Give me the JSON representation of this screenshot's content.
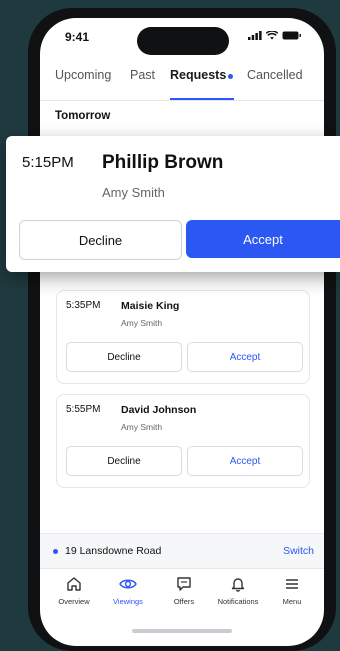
{
  "status_bar": {
    "time": "9:41"
  },
  "tabs": [
    {
      "label": "Upcoming"
    },
    {
      "label": "Past"
    },
    {
      "label": "Requests"
    },
    {
      "label": "Cancelled"
    }
  ],
  "active_tab": "Requests",
  "section_title": "Tomorrow",
  "highlight_request": {
    "time": "5:15PM",
    "name": "Phillip Brown",
    "agent": "Amy Smith",
    "decline_label": "Decline",
    "accept_label": "Accept"
  },
  "requests": [
    {
      "time": "5:35PM",
      "name": "Maisie King",
      "agent": "Amy Smith",
      "decline_label": "Decline",
      "accept_label": "Accept"
    },
    {
      "time": "5:55PM",
      "name": "David Johnson",
      "agent": "Amy Smith",
      "decline_label": "Decline",
      "accept_label": "Accept"
    }
  ],
  "property_bar": {
    "address": "19 Lansdowne Road",
    "switch_label": "Switch"
  },
  "bottom_nav": [
    {
      "label": "Overview",
      "icon": "home-icon"
    },
    {
      "label": "Viewings",
      "icon": "eye-icon",
      "active": true
    },
    {
      "label": "Offers",
      "icon": "chat-icon"
    },
    {
      "label": "Notifications",
      "icon": "bell-icon"
    },
    {
      "label": "Menu",
      "icon": "menu-icon"
    }
  ],
  "colors": {
    "accent": "#2b57f3",
    "background": "#1f3a3f"
  }
}
